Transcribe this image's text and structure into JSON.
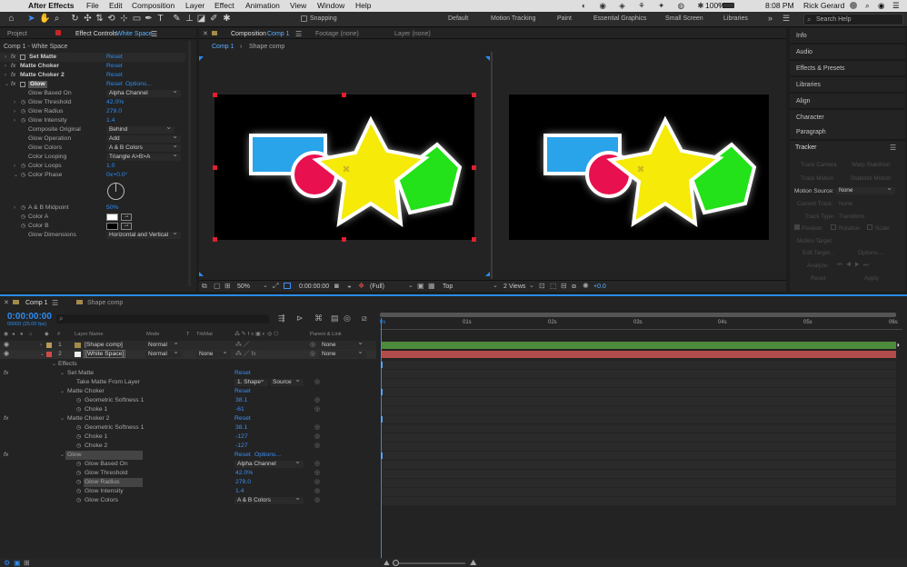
{
  "menubar": {
    "app_name": "After Effects",
    "menus": [
      "File",
      "Edit",
      "Composition",
      "Layer",
      "Effect",
      "Animation",
      "View",
      "Window",
      "Help"
    ],
    "battery": "100%",
    "time": "8:08 PM",
    "user": "Rick Gerard"
  },
  "toolbar": {
    "snapping_label": "Snapping",
    "workspaces": [
      "Default",
      "Motion Tracking",
      "Paint",
      "Essential Graphics",
      "Small Screen",
      "Libraries"
    ],
    "search_placeholder": "Search Help"
  },
  "effect_controls": {
    "tabs": [
      "Project",
      "Effect Controls",
      "White Space"
    ],
    "title": "Comp 1 - White Space",
    "effects": [
      {
        "name": "Set Matte",
        "reset": "Reset"
      },
      {
        "name": "Matte Choker",
        "reset": "Reset"
      },
      {
        "name": "Matte Choker 2",
        "reset": "Reset"
      },
      {
        "name": "Glow",
        "reset": "Reset",
        "options": "Options..."
      }
    ],
    "glow_props": [
      {
        "label": "Glow Based On",
        "value": "Alpha Channel"
      },
      {
        "label": "Glow Threshold",
        "value": "42.0%"
      },
      {
        "label": "Glow Radius",
        "value": "279.0"
      },
      {
        "label": "Glow Intensity",
        "value": "1.4"
      },
      {
        "label": "Composite Original",
        "value": "Behind"
      },
      {
        "label": "Glow Operation",
        "value": "Add"
      },
      {
        "label": "Glow Colors",
        "value": "A & B Colors"
      },
      {
        "label": "Color Looping",
        "value": "Triangle A>B>A"
      },
      {
        "label": "Color Loops",
        "value": "1.0"
      },
      {
        "label": "Color Phase",
        "value": "0x+0.0°"
      }
    ],
    "midpoint": {
      "label": "A & B Midpoint",
      "value": "50%"
    },
    "color_a": {
      "label": "Color A",
      "color": "#ffffff"
    },
    "color_b": {
      "label": "Color B",
      "color": "#000000"
    },
    "glow_dimensions": {
      "label": "Glow Dimensions",
      "value": "Horizontal and Vertical"
    }
  },
  "viewer": {
    "tabs": [
      "Composition",
      "Comp 1",
      "Footage (none)",
      "Layer (none)"
    ],
    "breadcrumbs": [
      "Comp 1",
      "Shape comp"
    ],
    "zoom": "50%",
    "timecode": "0:00:00:00",
    "resolution": "(Full)",
    "view": "Top",
    "views": "2 Views",
    "exposure": "+0.0"
  },
  "right_panel": {
    "sections": [
      "Info",
      "Audio",
      "Effects & Presets",
      "Libraries",
      "Align",
      "Character",
      "Paragraph"
    ],
    "tracker": {
      "title": "Tracker",
      "buttons": [
        "Track Camera",
        "Warp Stabilizer",
        "Track Motion",
        "Stabilize Motion"
      ],
      "motion_source_label": "Motion Source:",
      "motion_source_value": "None",
      "current_track_label": "Current Track:",
      "current_track_value": "None",
      "track_type_label": "Track Type:",
      "track_type_value": "Transform",
      "checkboxes": [
        "Position",
        "Rotation",
        "Scale"
      ],
      "motion_target_label": "Motion Target:",
      "edit_target": "Edit Target...",
      "options": "Options...",
      "analyze_label": "Analyze:",
      "reset": "Reset",
      "apply": "Apply"
    }
  },
  "timeline": {
    "tabs": [
      "Comp 1",
      "Shape comp"
    ],
    "timecode": "0:00:00:00",
    "fps": "00000 (25.00 fps)",
    "search_placeholder": "",
    "columns": {
      "layer_name": "Layer Name",
      "mode": "Mode",
      "t": "T",
      "trkmat": "TrkMat",
      "parent": "Parent & Link"
    },
    "layers": [
      {
        "num": "1",
        "name": "[Shape comp]",
        "mode": "Normal",
        "trkmat": "",
        "parent": "None"
      },
      {
        "num": "2",
        "name": "[White Space]",
        "mode": "Normal",
        "trkmat": "None",
        "parent": "None"
      }
    ],
    "effects_label": "Effects",
    "effect_rows": [
      {
        "name": "Set Matte",
        "reset": "Reset"
      },
      {
        "name": "Take Matte From Layer",
        "value": "1. Shape",
        "value2": "Source"
      },
      {
        "name": "Matte Choker",
        "reset": "Reset"
      },
      {
        "name": "Geometric Softness 1",
        "value": "38.1"
      },
      {
        "name": "Choke 1",
        "value": "-61"
      },
      {
        "name": "Matte Choker 2",
        "reset": "Reset"
      },
      {
        "name": "Geometric Softness 1",
        "value": "38.1"
      },
      {
        "name": "Choke 1",
        "value": "-127"
      },
      {
        "name": "Choke 2",
        "value": "-127"
      },
      {
        "name": "Glow",
        "reset": "Reset",
        "options": "Options..."
      },
      {
        "name": "Glow Based On",
        "value": "Alpha Channel"
      },
      {
        "name": "Glow Threshold",
        "value": "42.0%"
      },
      {
        "name": "Glow Radius",
        "value": "279.0"
      },
      {
        "name": "Glow Intensity",
        "value": "1.4"
      },
      {
        "name": "Glow Colors",
        "value": "A & B Colors"
      }
    ],
    "ruler": [
      "0s",
      "01s",
      "02s",
      "03s",
      "04s",
      "05s",
      "06s"
    ]
  }
}
